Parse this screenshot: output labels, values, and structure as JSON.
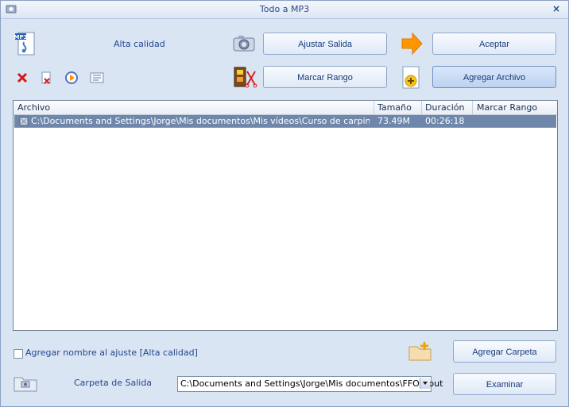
{
  "window": {
    "title": "Todo a MP3",
    "close": "×"
  },
  "toolbar": {
    "quality_label": "Alta calidad",
    "adjust_output": "Ajustar Salida",
    "accept": "Aceptar",
    "mark_range": "Marcar Rango",
    "add_file": "Agregar Archivo"
  },
  "table": {
    "headers": [
      "Archivo",
      "Tamaño",
      "Duración",
      "Marcar Rango"
    ],
    "rows": [
      {
        "file": "C:\\Documents and Settings\\Jorge\\Mis documentos\\Mis vídeos\\Curso de carpinteria\\Cu...",
        "size": "73.49M",
        "duration": "00:26:18",
        "range": ""
      }
    ]
  },
  "footer": {
    "append_label": "Agregar nombre al ajuste [Alta calidad]",
    "add_folder": "Agregar Carpeta",
    "output_folder_label": "Carpeta de Salida",
    "output_path": "C:\\Documents and Settings\\Jorge\\Mis documentos\\FFOutput",
    "browse": "Examinar"
  },
  "icons": {
    "mp3": "mp3-file-icon",
    "delete": "red-x-icon",
    "clear": "clear-list-icon",
    "play": "play-icon",
    "info": "info-card-icon",
    "camera": "camera-icon",
    "film": "film-scissors-icon",
    "arrow": "orange-arrow-icon",
    "add": "add-file-icon",
    "folder": "folder-add-icon",
    "output_folder": "output-folder-icon"
  }
}
